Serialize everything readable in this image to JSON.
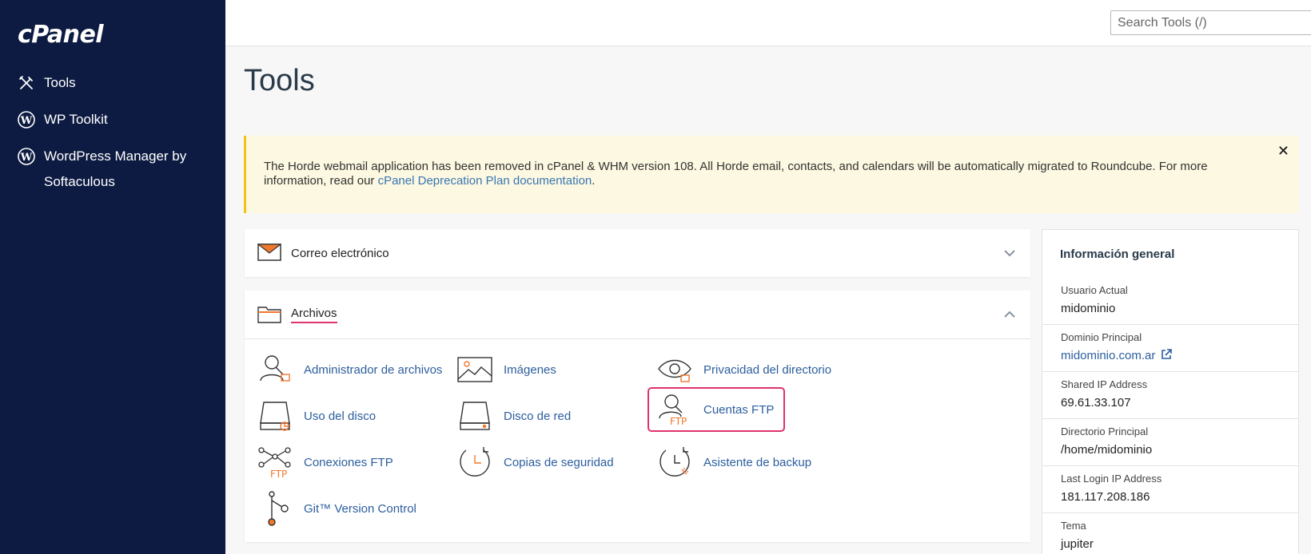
{
  "brand": {
    "logo": "cPanel"
  },
  "sidebar": {
    "items": [
      {
        "label": "Tools",
        "icon": "tools-icon"
      },
      {
        "label": "WP Toolkit",
        "icon": "wordpress-icon"
      },
      {
        "label": "WordPress Manager by Softaculous",
        "icon": "wordpress-icon"
      }
    ]
  },
  "topbar": {
    "search_placeholder": "Search Tools (/)"
  },
  "page": {
    "title": "Tools"
  },
  "notice": {
    "text": "The Horde webmail application has been removed in cPanel & WHM version 108. All Horde email, contacts, and calendars will be automatically migrated to Roundcube. For more information, read our ",
    "link_text": "cPanel Deprecation Plan documentation",
    "suffix": ".",
    "close_label": "✕"
  },
  "panels": {
    "email": {
      "title": "Correo electrónico",
      "expanded": false
    },
    "files": {
      "title": "Archivos",
      "expanded": true,
      "tools": [
        {
          "label": "Administrador de archivos",
          "icon": "file-manager-icon"
        },
        {
          "label": "Imágenes",
          "icon": "images-icon"
        },
        {
          "label": "Privacidad del directorio",
          "icon": "directory-privacy-icon"
        },
        {
          "label": "Uso del disco",
          "icon": "disk-usage-icon"
        },
        {
          "label": "Disco de red",
          "icon": "web-disk-icon"
        },
        {
          "label": "Cuentas FTP",
          "icon": "ftp-accounts-icon"
        },
        {
          "label": "Conexiones FTP",
          "icon": "ftp-connections-icon"
        },
        {
          "label": "Copias de seguridad",
          "icon": "backup-icon"
        },
        {
          "label": "Asistente de backup",
          "icon": "backup-wizard-icon"
        },
        {
          "label": "Git™ Version Control",
          "icon": "git-icon"
        }
      ]
    }
  },
  "info": {
    "title": "Información general",
    "rows": [
      {
        "key": "Usuario Actual",
        "value": "midominio"
      },
      {
        "key": "Dominio Principal",
        "value": "midominio.com.ar"
      },
      {
        "key": "Shared IP Address",
        "value": "69.61.33.107"
      },
      {
        "key": "Directorio Principal",
        "value": "/home/midominio"
      },
      {
        "key": "Last Login IP Address",
        "value": "181.117.208.186"
      },
      {
        "key": "Tema",
        "value": "jupiter"
      }
    ]
  },
  "colors": {
    "sidebar": "#0d1b42",
    "accent_orange": "#f0772e",
    "highlight": "#e0326d",
    "link": "#2c5e9e"
  }
}
